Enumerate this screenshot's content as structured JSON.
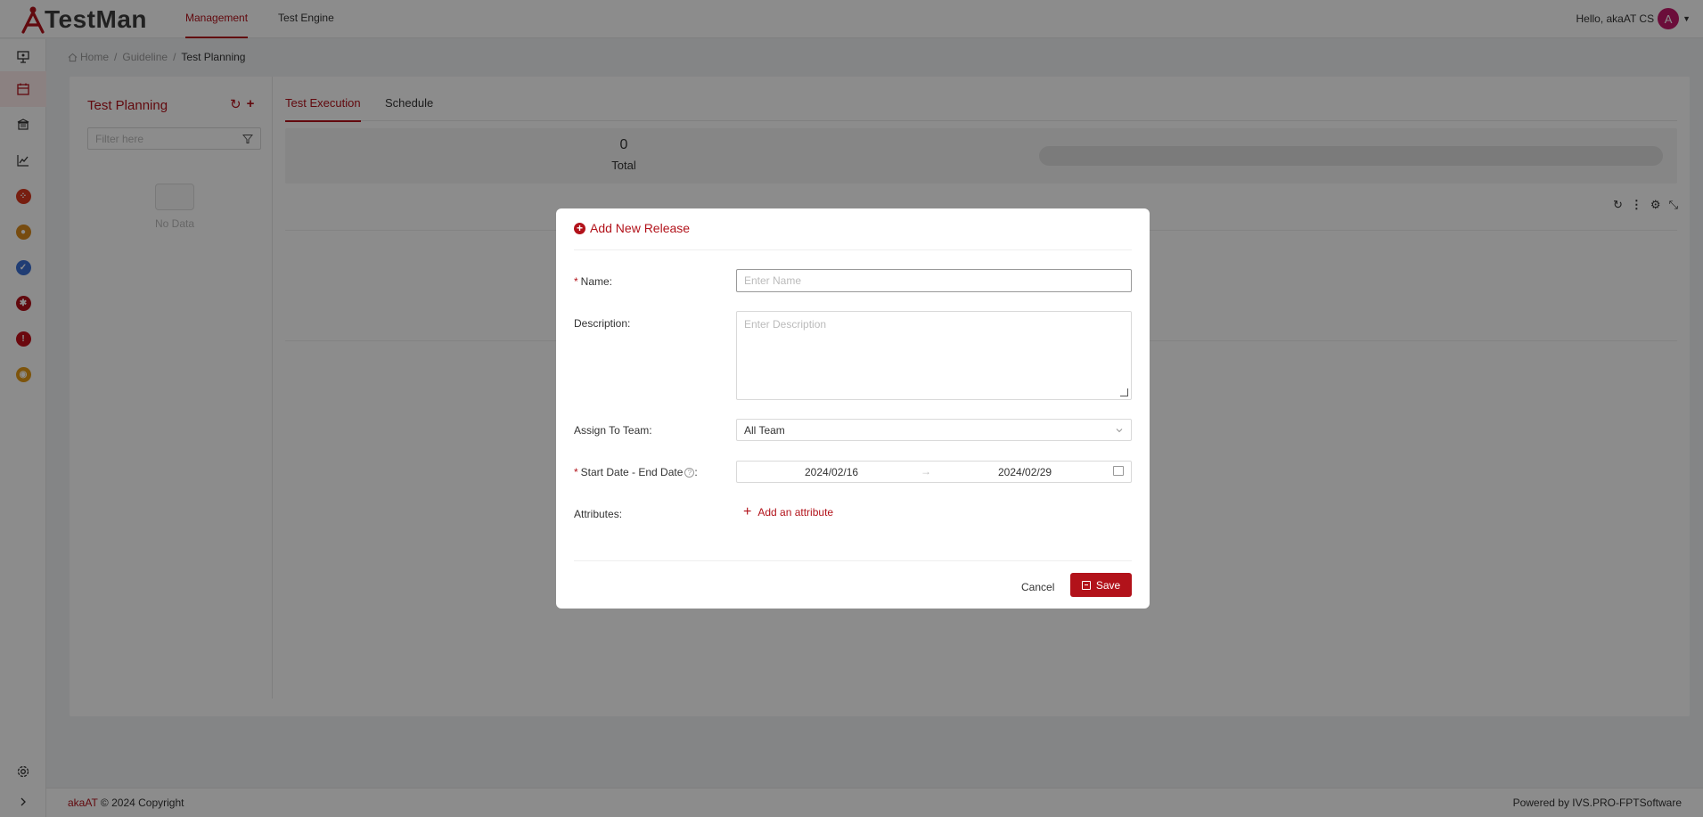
{
  "app": {
    "logo_prefix": "A",
    "logo_text": "TestMan",
    "brand_color": "#b2121a"
  },
  "topnav": [
    {
      "label": "Management",
      "active": true
    },
    {
      "label": "Test Engine",
      "active": false
    }
  ],
  "user": {
    "greeting": "Hello, akaAT CS",
    "avatar_letter": "A"
  },
  "rail": {
    "icons": [
      "presentation-icon",
      "calendar-icon",
      "library-icon",
      "chart-line-icon",
      "group-icon",
      "bulb-icon",
      "check-circle-icon",
      "bug-icon",
      "alert-icon",
      "record-icon",
      "gear-icon",
      "chevron-right-icon"
    ]
  },
  "breadcrumb": {
    "items": [
      "Home",
      "Guideline",
      "Test Planning"
    ],
    "separator": "/"
  },
  "left_panel": {
    "title": "Test Planning",
    "filter_placeholder": "Filter here",
    "empty_text": "No Data"
  },
  "tabs": [
    {
      "label": "Test Execution",
      "active": true
    },
    {
      "label": "Schedule",
      "active": false
    }
  ],
  "stats": {
    "total_value": "0",
    "total_label": "Total"
  },
  "footer": {
    "brand": "akaAT",
    "copyright": "© 2024 Copyright",
    "powered_by": "Powered by",
    "powered_name": "IVS.PRO-FPTSoftware"
  },
  "modal": {
    "title": "Add New Release",
    "name_label": "Name:",
    "name_placeholder": "Enter Name",
    "description_label": "Description:",
    "description_placeholder": "Enter Description",
    "team_label": "Assign To Team:",
    "team_value": "All Team",
    "date_label": "Start Date - End Date",
    "date_suffix": ":",
    "start_date": "2024/02/16",
    "date_arrow": "→",
    "end_date": "2024/02/29",
    "attributes_label": "Attributes:",
    "add_attribute": "Add an attribute",
    "cancel_label": "Cancel",
    "save_label": "Save",
    "required_mark": "*"
  }
}
